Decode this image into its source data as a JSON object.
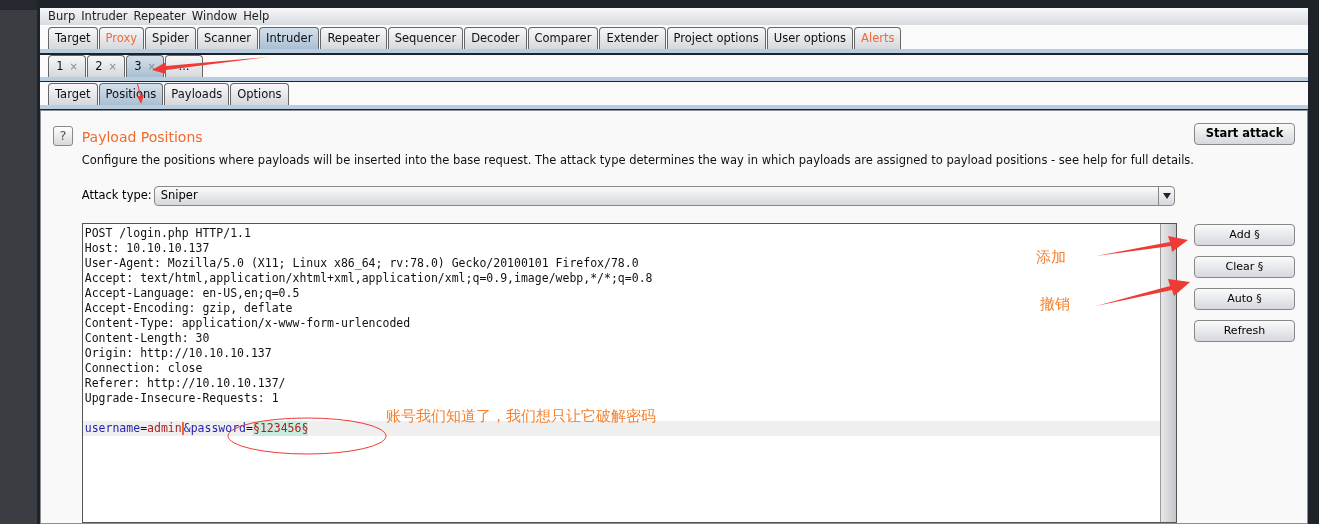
{
  "menu": [
    "Burp",
    "Intruder",
    "Repeater",
    "Window",
    "Help"
  ],
  "main_tabs": [
    {
      "label": "Target",
      "selected": false,
      "highlighted": false
    },
    {
      "label": "Proxy",
      "selected": false,
      "highlighted": true
    },
    {
      "label": "Spider",
      "selected": false,
      "highlighted": false
    },
    {
      "label": "Scanner",
      "selected": false,
      "highlighted": false
    },
    {
      "label": "Intruder",
      "selected": true,
      "highlighted": false
    },
    {
      "label": "Repeater",
      "selected": false,
      "highlighted": false
    },
    {
      "label": "Sequencer",
      "selected": false,
      "highlighted": false
    },
    {
      "label": "Decoder",
      "selected": false,
      "highlighted": false
    },
    {
      "label": "Comparer",
      "selected": false,
      "highlighted": false
    },
    {
      "label": "Extender",
      "selected": false,
      "highlighted": false
    },
    {
      "label": "Project options",
      "selected": false,
      "highlighted": false
    },
    {
      "label": "User options",
      "selected": false,
      "highlighted": false
    },
    {
      "label": "Alerts",
      "selected": false,
      "highlighted": true
    }
  ],
  "attack_tabs": [
    {
      "label": "1",
      "close": "×",
      "selected": false
    },
    {
      "label": "2",
      "close": "×",
      "selected": false
    },
    {
      "label": "3",
      "close": "×",
      "selected": true
    },
    {
      "label": "...",
      "selected": false
    }
  ],
  "sub_tabs": [
    {
      "label": "Target",
      "selected": false
    },
    {
      "label": "Positions",
      "selected": true
    },
    {
      "label": "Payloads",
      "selected": false
    },
    {
      "label": "Options",
      "selected": false
    }
  ],
  "panel": {
    "help": "?",
    "title": "Payload Positions",
    "description": "Configure the positions where payloads will be inserted into the base request. The attack type determines the way in which payloads are assigned to payload positions - see help for full details.",
    "attack_type_label": "Attack type:",
    "attack_type": "Sniper",
    "start_button": "Start attack",
    "side_buttons": [
      "Add §",
      "Clear §",
      "Auto §",
      "Refresh"
    ],
    "request_lines": [
      "POST /login.php HTTP/1.1",
      "Host: 10.10.10.137",
      "User-Agent: Mozilla/5.0 (X11; Linux x86_64; rv:78.0) Gecko/20100101 Firefox/78.0",
      "Accept: text/html,application/xhtml+xml,application/xml;q=0.9,image/webp,*/*;q=0.8",
      "Accept-Language: en-US,en;q=0.5",
      "Accept-Encoding: gzip, deflate",
      "Content-Type: application/x-www-form-urlencoded",
      "Content-Length: 30",
      "Origin: http://10.10.10.137",
      "Connection: close",
      "Referer: http://10.10.10.137/",
      "Upgrade-Insecure-Requests: 1"
    ],
    "body": [
      {
        "kind": "name",
        "text": "username"
      },
      {
        "kind": "plain",
        "text": "="
      },
      {
        "kind": "value",
        "text": "admin"
      },
      {
        "kind": "caret"
      },
      {
        "kind": "name",
        "text": "&password"
      },
      {
        "kind": "plain",
        "text": "="
      },
      {
        "kind": "marked",
        "text": "§123456§"
      }
    ]
  },
  "annotations": [
    {
      "kind": "label",
      "text": "添加"
    },
    {
      "kind": "label",
      "text": "撤销"
    },
    {
      "kind": "label",
      "text": "账号我们知道了，我们想只让它破解密码"
    }
  ]
}
